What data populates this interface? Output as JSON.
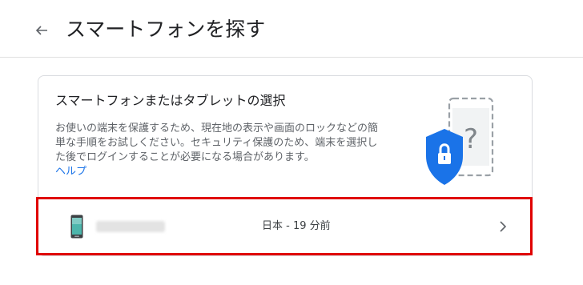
{
  "header": {
    "back_icon": "arrow-left-icon",
    "title": "スマートフォンを探す"
  },
  "card": {
    "title": "スマートフォンまたはタブレットの選択",
    "description": "お使いの端末を保護するため、現在地の表示や画面のロックなどの簡単な手順をお試しください。セキュリティ保護のため、端末を選択した後でログインすることが必要になる場合があります。",
    "help_link": "ヘルプ",
    "illustration_icon": "phone-shield-lock-icon"
  },
  "device": {
    "icon": "smartphone-icon",
    "location_time": "日本 - 19 分前",
    "chevron_icon": "chevron-right-icon"
  },
  "colors": {
    "link": "#1a73e8",
    "shield": "#1a73e8",
    "highlight": "#e00000"
  }
}
